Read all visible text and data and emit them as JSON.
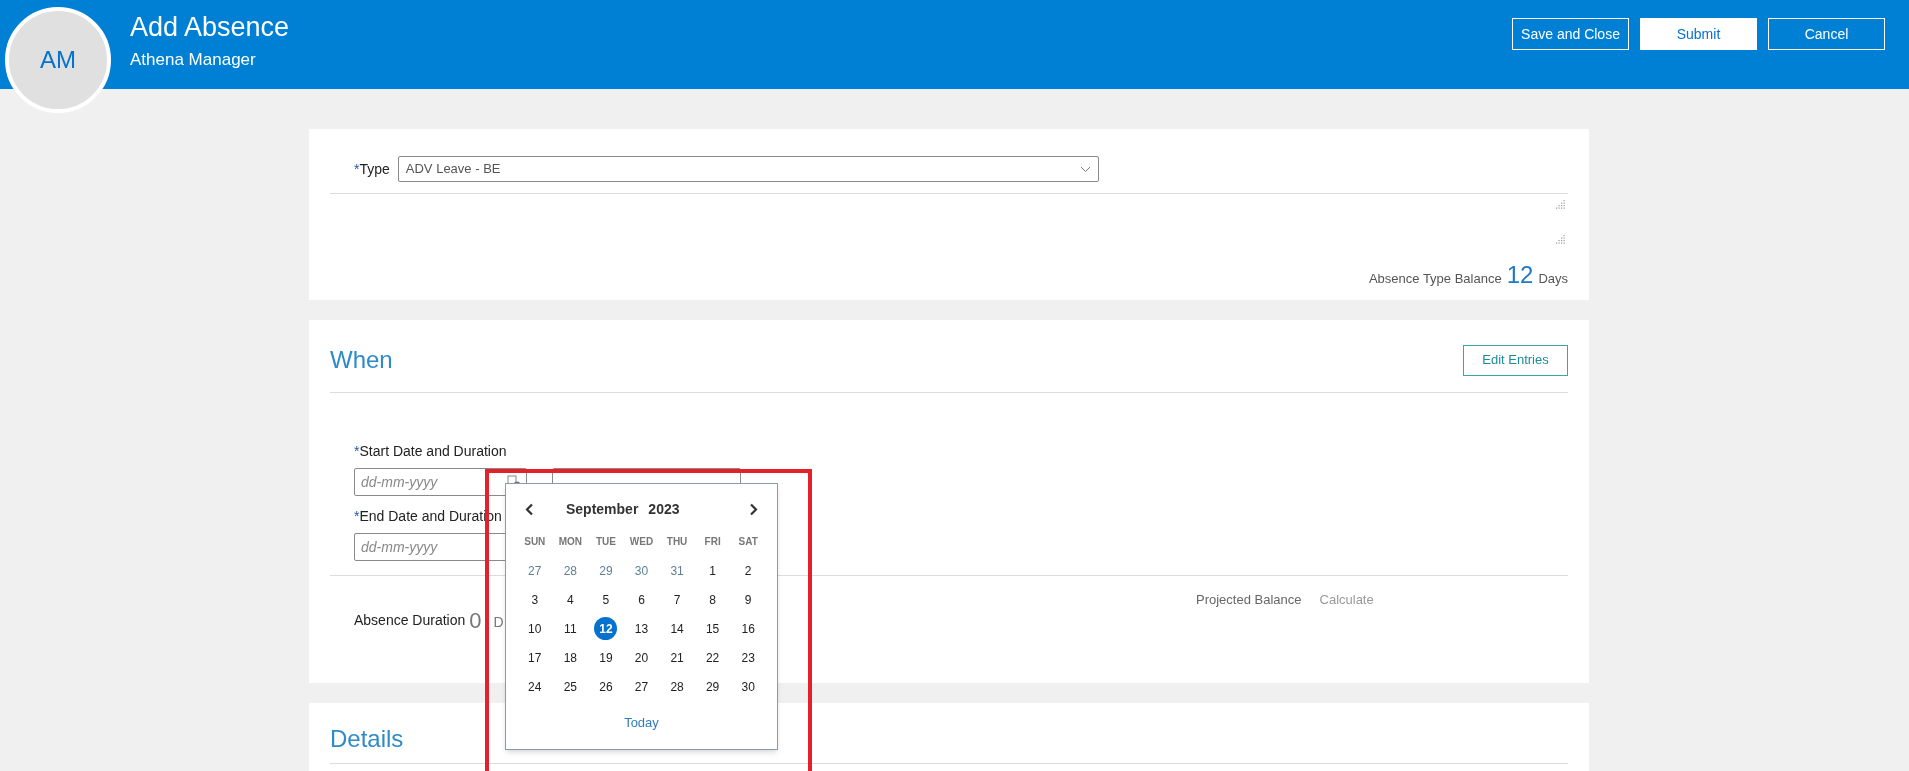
{
  "header": {
    "avatar_initials": "AM",
    "title": "Add Absence",
    "subtitle": "Athena Manager",
    "buttons": [
      {
        "label": "Save and Close",
        "kind": "outline"
      },
      {
        "label": "Submit",
        "kind": "primary"
      },
      {
        "label": "Cancel",
        "kind": "outline"
      }
    ]
  },
  "type_card": {
    "marker": "*",
    "label": "Type",
    "value": "ADV Leave - BE",
    "balance_label": "Absence Type Balance",
    "balance_value": "12",
    "balance_unit": "Days"
  },
  "when": {
    "heading": "When",
    "edit_button": "Edit Entries",
    "start_marker": "*",
    "start_label": "Start Date and Duration",
    "start_placeholder": "dd-mm-yyyy",
    "end_marker": "*",
    "end_label": "End Date and Duration",
    "end_placeholder": "dd-mm-yyyy",
    "duration_label": "Absence Duration",
    "duration_value": "0",
    "duration_unit": "D",
    "projected_label": "Projected Balance",
    "calculate_link": "Calculate"
  },
  "calendar": {
    "month": "September",
    "year": "2023",
    "weekdays": [
      "SUN",
      "MON",
      "TUE",
      "WED",
      "THU",
      "FRI",
      "SAT"
    ],
    "days": [
      {
        "label": "27",
        "muted": true,
        "selected": false
      },
      {
        "label": "28",
        "muted": true,
        "selected": false
      },
      {
        "label": "29",
        "muted": true,
        "selected": false
      },
      {
        "label": "30",
        "muted": true,
        "selected": false
      },
      {
        "label": "31",
        "muted": true,
        "selected": false
      },
      {
        "label": "1",
        "muted": false,
        "selected": false
      },
      {
        "label": "2",
        "muted": false,
        "selected": false
      },
      {
        "label": "3",
        "muted": false,
        "selected": false
      },
      {
        "label": "4",
        "muted": false,
        "selected": false
      },
      {
        "label": "5",
        "muted": false,
        "selected": false
      },
      {
        "label": "6",
        "muted": false,
        "selected": false
      },
      {
        "label": "7",
        "muted": false,
        "selected": false
      },
      {
        "label": "8",
        "muted": false,
        "selected": false
      },
      {
        "label": "9",
        "muted": false,
        "selected": false
      },
      {
        "label": "10",
        "muted": false,
        "selected": false
      },
      {
        "label": "11",
        "muted": false,
        "selected": false
      },
      {
        "label": "12",
        "muted": false,
        "selected": true
      },
      {
        "label": "13",
        "muted": false,
        "selected": false
      },
      {
        "label": "14",
        "muted": false,
        "selected": false
      },
      {
        "label": "15",
        "muted": false,
        "selected": false
      },
      {
        "label": "16",
        "muted": false,
        "selected": false
      },
      {
        "label": "17",
        "muted": false,
        "selected": false
      },
      {
        "label": "18",
        "muted": false,
        "selected": false
      },
      {
        "label": "19",
        "muted": false,
        "selected": false
      },
      {
        "label": "20",
        "muted": false,
        "selected": false
      },
      {
        "label": "21",
        "muted": false,
        "selected": false
      },
      {
        "label": "22",
        "muted": false,
        "selected": false
      },
      {
        "label": "23",
        "muted": false,
        "selected": false
      },
      {
        "label": "24",
        "muted": false,
        "selected": false
      },
      {
        "label": "25",
        "muted": false,
        "selected": false
      },
      {
        "label": "26",
        "muted": false,
        "selected": false
      },
      {
        "label": "27",
        "muted": false,
        "selected": false
      },
      {
        "label": "28",
        "muted": false,
        "selected": false
      },
      {
        "label": "29",
        "muted": false,
        "selected": false
      },
      {
        "label": "30",
        "muted": false,
        "selected": false
      }
    ],
    "today_link": "Today"
  },
  "details": {
    "heading": "Details"
  }
}
